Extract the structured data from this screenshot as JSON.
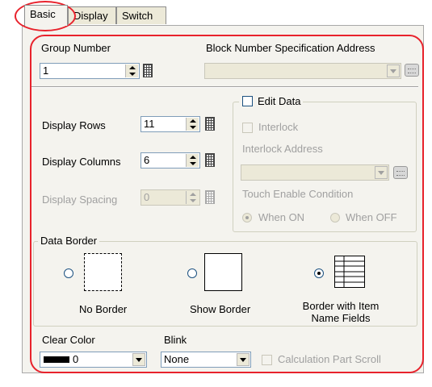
{
  "tabs": [
    {
      "label": "Basic",
      "active": true
    },
    {
      "label": "Display",
      "active": false
    },
    {
      "label": "Switch",
      "active": false
    }
  ],
  "group_number": {
    "label": "Group Number",
    "value": "1"
  },
  "block_address": {
    "label": "Block Number Specification Address",
    "value": ""
  },
  "display_rows": {
    "label": "Display Rows",
    "value": "11"
  },
  "display_columns": {
    "label": "Display Columns",
    "value": "6"
  },
  "display_spacing": {
    "label": "Display Spacing",
    "value": "0"
  },
  "edit_data": {
    "label": "Edit Data",
    "interlock_label": "Interlock",
    "interlock_address_label": "Interlock Address",
    "interlock_address_value": "",
    "touch_enable_label": "Touch Enable Condition",
    "when_on": "When ON",
    "when_off": "When OFF"
  },
  "data_border": {
    "title": "Data Border",
    "options": [
      "No Border",
      "Show Border",
      "Border with Item Name Fields"
    ],
    "selected": "Border with Item Name Fields"
  },
  "clear_color": {
    "label": "Clear Color",
    "value": "0",
    "swatch": "#000000"
  },
  "blink": {
    "label": "Blink",
    "value": "None"
  },
  "calc_scroll": {
    "label": "Calculation Part Scroll"
  },
  "colors": {
    "annotation": "#e8222c",
    "panel": "#f4f3ee"
  }
}
